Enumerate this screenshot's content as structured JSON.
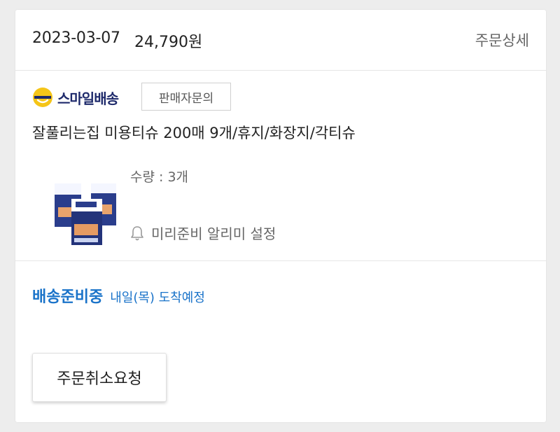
{
  "order": {
    "date": "2023-03-07",
    "amount": "24,790원",
    "detail_link": "주문상세"
  },
  "delivery_service": {
    "brand": "스마일배송",
    "icon": "smile-face-icon",
    "brand_color": "#f5c518"
  },
  "seller_inquiry_label": "판매자문의",
  "product": {
    "title": "잘풀리는집 미용티슈 200매 9개/휴지/화장지/각티슈",
    "quantity": "수량 : 3개",
    "image": "tissue-box-product-image"
  },
  "alarm": {
    "icon": "bell-icon",
    "label": "미리준비 알리미 설정"
  },
  "shipping": {
    "status": "배송준비중",
    "eta": "내일(목) 도착예정",
    "color": "#1a73c9"
  },
  "actions": {
    "cancel_label": "주문취소요청"
  }
}
